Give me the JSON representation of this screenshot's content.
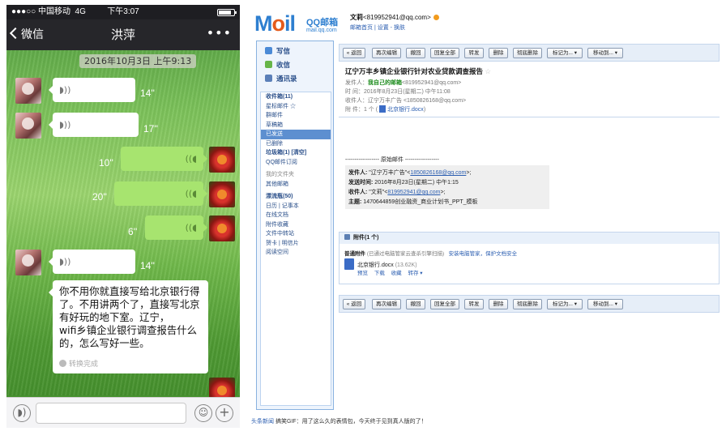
{
  "phone": {
    "status": {
      "carrier": "●●●○○ 中国移动",
      "network": "4G",
      "time": "下午3:07"
    },
    "nav": {
      "back_label": "微信",
      "title": "洪萍",
      "more": "•••"
    },
    "timestamp": "2016年10月3日 上午9:13",
    "voice_messages": [
      {
        "sender": "contact",
        "duration": "14''"
      },
      {
        "sender": "contact",
        "duration": "17''"
      },
      {
        "sender": "me",
        "duration": "10''"
      },
      {
        "sender": "me",
        "duration": "20''"
      },
      {
        "sender": "me",
        "duration": "6''"
      },
      {
        "sender": "contact",
        "duration": "14''"
      }
    ],
    "voice_icon": "voice-wave-icon",
    "text_message": "你不用你就直接写给北京银行得了。不用讲两个了，直接写北京有好玩的地下室。辽宁，\nwifi乡镇企业银行调查报告什么的，怎么写好一些。",
    "converted_label": "转换完成",
    "input_icons": [
      "voice-toggle-icon",
      "emoji-icon",
      "plus-icon"
    ]
  },
  "mail": {
    "logo": {
      "brand_m": "M",
      "brand_o": "o",
      "brand_rest": "il",
      "qq": "QQ邮箱",
      "url": "mail.qq.com"
    },
    "account": {
      "name": "文莉",
      "email": "<819952941@qq.com>"
    },
    "links": [
      "邮箱首页",
      "设置",
      "换肤"
    ],
    "sidebar_top": [
      {
        "label": "写信",
        "icon": "compose-icon",
        "color": "#4b8ad6"
      },
      {
        "label": "收信",
        "icon": "inbox-icon",
        "color": "#67b548"
      },
      {
        "label": "通讯录",
        "icon": "contacts-icon",
        "color": "#5b7fb8"
      }
    ],
    "sidebar_folders": [
      {
        "label": "收件箱(11)",
        "bold": true
      },
      {
        "label": "星标邮件 ☆"
      },
      {
        "label": "群邮件"
      },
      {
        "label": "草稿箱"
      },
      {
        "label": "已发送",
        "selected": true
      },
      {
        "label": "已删除"
      },
      {
        "label": "垃圾箱(1)   [清空]",
        "bold": true
      },
      {
        "label": "QQ邮件订阅"
      },
      {
        "label": ""
      },
      {
        "label": "我的文件夹",
        "gray": true
      },
      {
        "label": "其他邮箱"
      },
      {
        "label": ""
      },
      {
        "label": "漂流瓶(50)",
        "bold": true
      },
      {
        "label": "日历 | 记事本"
      },
      {
        "label": "在线文档"
      },
      {
        "label": "附件收藏"
      },
      {
        "label": "文件中转站"
      },
      {
        "label": "贺卡 | 明信片"
      },
      {
        "label": "阅读空间"
      }
    ],
    "toolbar": [
      "« 返回",
      "再次编辑",
      "撤回",
      "回复全部",
      "转发",
      "删除",
      "彻底删除",
      "标记为... ▾",
      "移动到... ▾"
    ],
    "email": {
      "subject": "辽宁万丰乡镇企业银行针对农业贷款调查报告",
      "from_label": "发件人：",
      "from_name": "我自己的邮箱",
      "from_email": "<819952941@qq.com>",
      "time_label": "时  间：",
      "time_value": "2016年8月23日(星期二) 中午11:08",
      "to_label": "收件人：",
      "to_value": "辽宁万丰广告 <1850826168@qq.com>",
      "attach_label": "附  件：",
      "attach_count": "1 个",
      "attach_name": "北京银行.docx"
    },
    "original": {
      "divider": "------------------ 原始邮件 ------------------",
      "from_label": "发件人:",
      "from_value": "\"辽宁万丰广告\"<",
      "from_email": "1850826168@qq.com",
      "from_end": ">;",
      "time_label": "发送时间:",
      "time_value": "2016年8月23日(星期二) 中午1:15",
      "to_label": "收件人:",
      "to_value": "\"文莉\"<",
      "to_email": "819952941@qq.com",
      "to_end": ">;",
      "subject_label": "主题:",
      "subject_value": "1470644859创业融资_商业计划书_PPT_模板"
    },
    "attachments": {
      "header": "附件(1 个)",
      "normal_label": "普通附件",
      "normal_note": "(已通过电脑管家云查杀引擎扫描)",
      "security_link": "安装电脑管家，保护文档安全",
      "file_name": "北京银行.docx",
      "file_size": "(13.62K)",
      "actions": [
        "预览",
        "下载",
        "收藏",
        "转存 ▾"
      ]
    },
    "footer": {
      "prefix": "头条新闻",
      "text": "搞笑GIF：用了这么久的表情包，今天终于见到真人版的了！"
    }
  }
}
